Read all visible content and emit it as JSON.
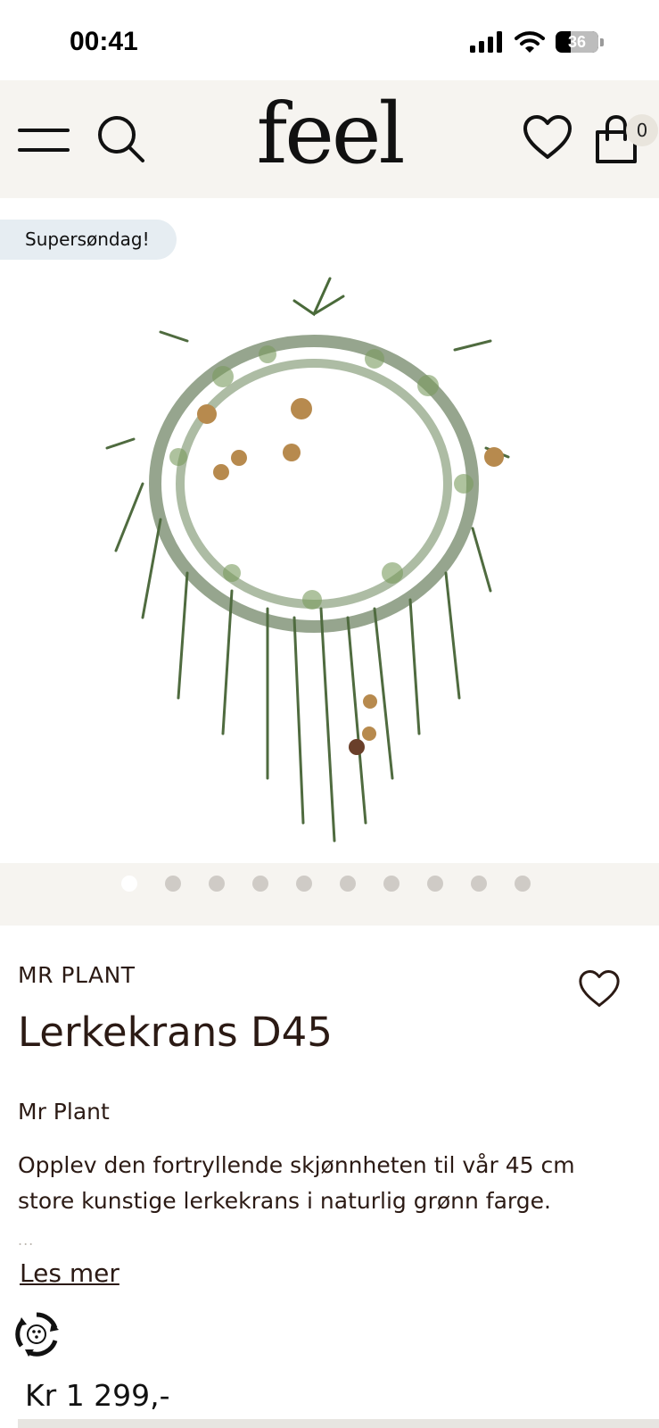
{
  "status_bar": {
    "time": "00:41",
    "battery": "36",
    "battery_level": 0.36,
    "icons": [
      "signal-icon",
      "wifi-icon",
      "battery-icon"
    ]
  },
  "header": {
    "logo": "feel",
    "cart_count": "0",
    "icons": [
      "menu-icon",
      "search-icon",
      "heart-icon",
      "shopping-bag-icon"
    ],
    "background": "#f6f4f0"
  },
  "gallery": {
    "badge": "Supersøndag!",
    "badge_color": "#e6edf2",
    "image": "wreath-image",
    "dots_count": 10,
    "active_dot": 1
  },
  "product": {
    "brand": "MR PLANT",
    "title": "Lerkekrans D45",
    "vendor": "Mr Plant",
    "description": "Opplev den fortryllende skjønnheten til vår 45 cm store kunstige lerkekrans i naturlig grønn farge.",
    "ellipsis": "...",
    "read_more": "Les mer",
    "price": "Kr 1 299,-",
    "text_color": "#2b1a14"
  }
}
